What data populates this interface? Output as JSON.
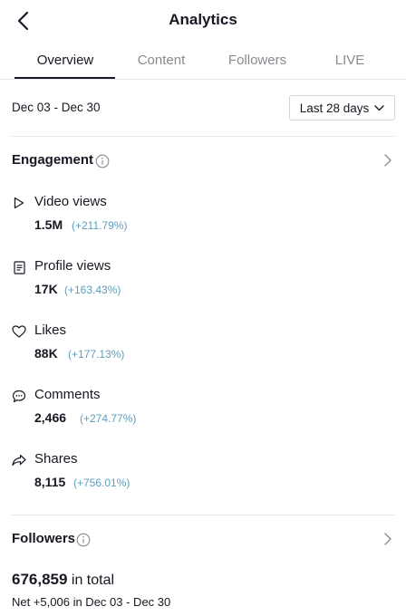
{
  "header": {
    "title": "Analytics"
  },
  "tabs": [
    {
      "label": "Overview",
      "active": true
    },
    {
      "label": "Content",
      "active": false
    },
    {
      "label": "Followers",
      "active": false
    },
    {
      "label": "LIVE",
      "active": false
    }
  ],
  "date_range": "Dec 03 - Dec 30",
  "period_select": {
    "value": "Last 28 days"
  },
  "engagement": {
    "title": "Engagement",
    "metrics": [
      {
        "label": "Video views",
        "value": "1.5M",
        "change": "(+211.79%)",
        "icon": "play-icon"
      },
      {
        "label": "Profile views",
        "value": "17K",
        "change": "(+163.43%)",
        "icon": "profile-card-icon"
      },
      {
        "label": "Likes",
        "value": "88K",
        "change": "(+177.13%)",
        "icon": "heart-icon"
      },
      {
        "label": "Comments",
        "value": "2,466",
        "change": "(+274.77%)",
        "icon": "comment-icon"
      },
      {
        "label": "Shares",
        "value": "8,115",
        "change": "(+756.01%)",
        "icon": "share-icon"
      }
    ]
  },
  "followers": {
    "title": "Followers",
    "total": "676,859",
    "total_suffix": "in total",
    "net": "Net +5,006 in Dec 03 - Dec 30"
  },
  "colors": {
    "text": "#161823",
    "muted": "#8a8b91",
    "change": "#5d9fbb",
    "divider": "#e6e6e8"
  }
}
